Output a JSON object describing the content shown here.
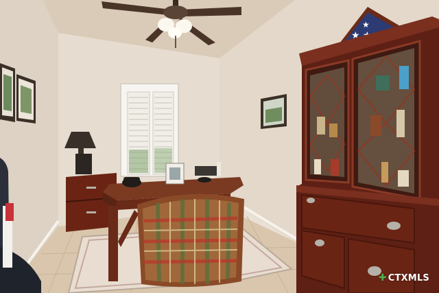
{
  "photo": {
    "subject": "home-office",
    "colors": {
      "ceiling": "#d9cbb8",
      "wall_left": "#ddd2c4",
      "wall_back": "#e6ddd0",
      "wall_right": "#e3d8ca",
      "floor": "#d9c6ad",
      "wood_dark": "#5e2014",
      "wood_mid": "#7a2f1f",
      "flag_blue": "#2c3b73"
    }
  },
  "watermark": {
    "brand": "CTXMLS",
    "icon": "ctxmls-logo-icon"
  }
}
